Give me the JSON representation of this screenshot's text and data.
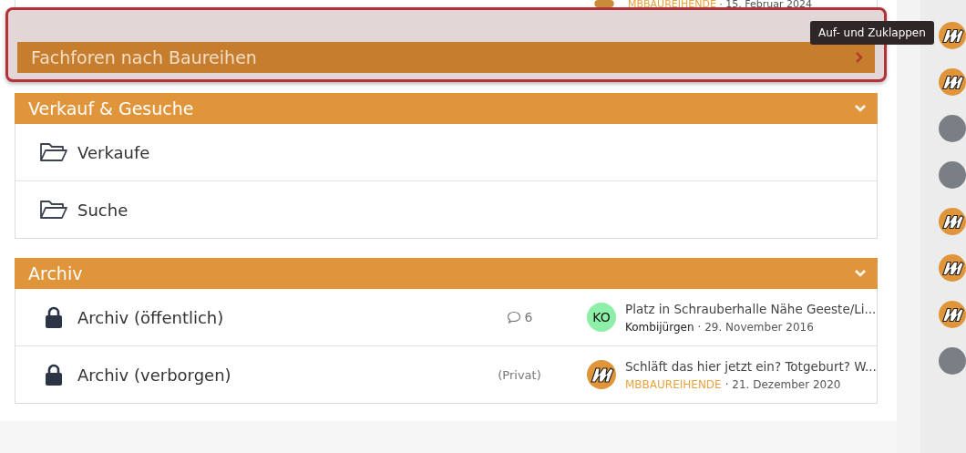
{
  "top_row": {
    "author": "MBBAUREIHENDE",
    "date": "· 15. Februar 2024"
  },
  "tooltip": "Auf- und Zuklappen",
  "categories": [
    {
      "title": "Fachforen nach Baureihen",
      "expanded": false,
      "highlighted": true
    },
    {
      "title": "Verkauf & Gesuche",
      "expanded": true,
      "highlighted": false,
      "forums": [
        {
          "kind": "folder",
          "name": "Verkaufe"
        },
        {
          "kind": "folder",
          "name": "Suche"
        }
      ]
    },
    {
      "title": "Archiv",
      "expanded": true,
      "highlighted": false,
      "forums": [
        {
          "kind": "lock",
          "name": "Archiv (öffentlich)",
          "replies": "6",
          "last_post": {
            "title": "Platz in Schrauberhalle Nähe Geeste/Li...",
            "author": "Kombijürgen",
            "author_staff": false,
            "date": "· 29. November 2016",
            "avatar": {
              "kind": "initials",
              "text": "KO",
              "color": "#8ef0a8"
            }
          }
        },
        {
          "kind": "lock",
          "name": "Archiv (verborgen)",
          "note": "(Privat)",
          "last_post": {
            "title": "Schläft das hier jetzt ein? Totgeburt? W...",
            "author": "MBBAUREIHENDE",
            "author_staff": true,
            "date": "· 21. Dezember 2020",
            "avatar": {
              "kind": "logo"
            }
          }
        }
      ]
    }
  ],
  "sidebar_avatars": [
    {
      "kind": "logo"
    },
    {
      "kind": "logo"
    },
    {
      "kind": "photo"
    },
    {
      "kind": "photo"
    },
    {
      "kind": "logo"
    },
    {
      "kind": "logo"
    },
    {
      "kind": "logo"
    },
    {
      "kind": "photo"
    }
  ]
}
